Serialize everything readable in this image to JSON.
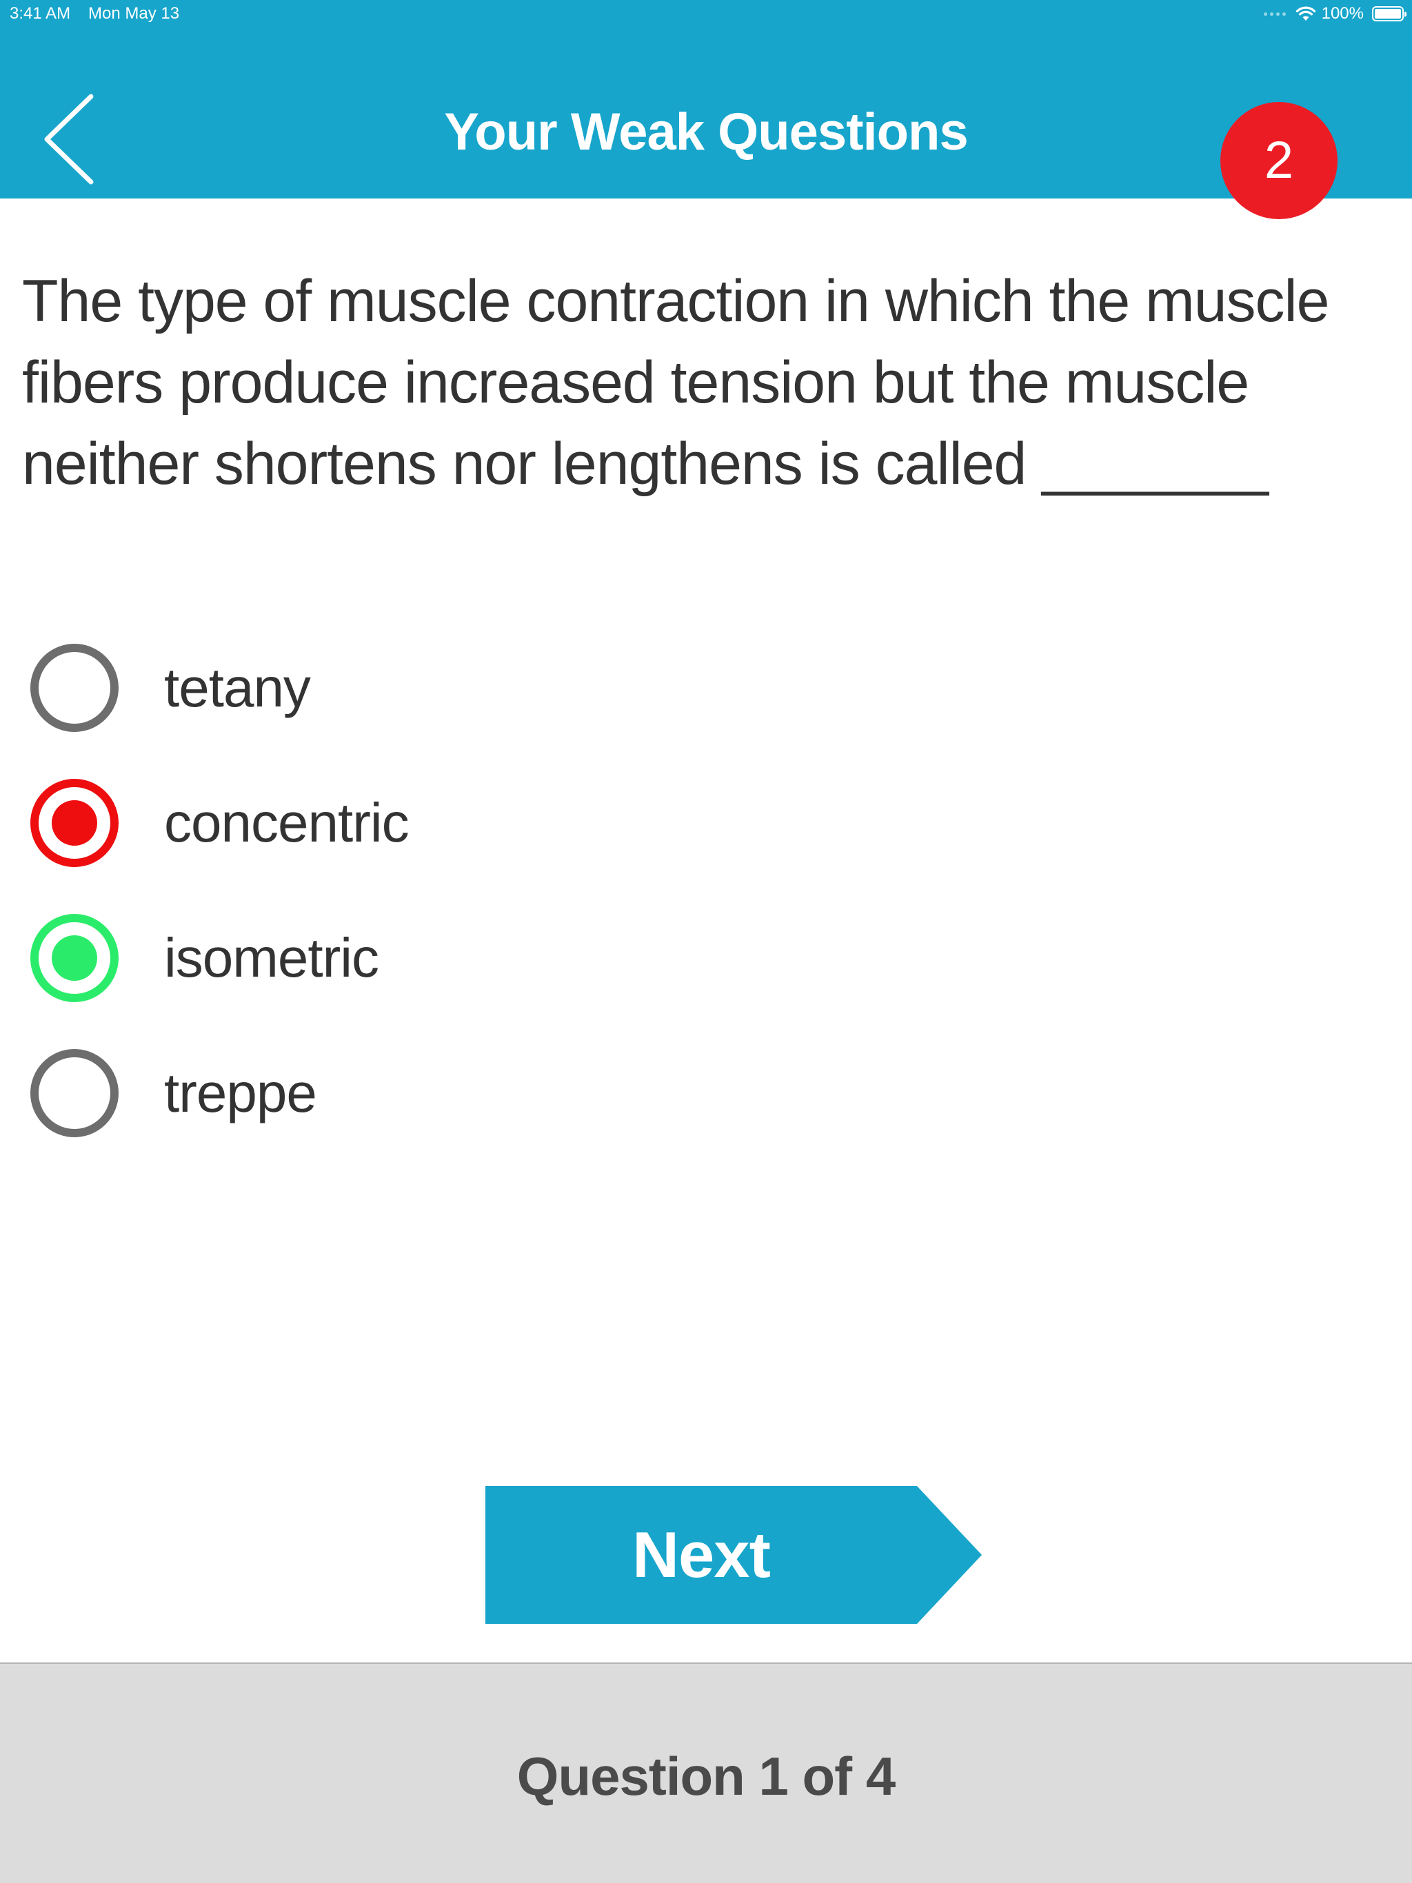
{
  "status_bar": {
    "time": "3:41 AM",
    "date": "Mon May 13",
    "battery_percent": "100%",
    "battery_level": 1.0,
    "wifi_icon": "wifi-icon",
    "battery_icon": "battery-icon"
  },
  "nav": {
    "back_icon": "chevron-left-icon",
    "title": "Your Weak Questions",
    "badge_count": "2"
  },
  "question": {
    "text": "The type of muscle contraction in which the muscle fibers produce increased tension but the muscle neither shortens nor lengthens is called _______"
  },
  "options": [
    {
      "label": "tetany",
      "state": "unselected"
    },
    {
      "label": "concentric",
      "state": "selected-wrong"
    },
    {
      "label": "isometric",
      "state": "correct"
    },
    {
      "label": "treppe",
      "state": "unselected"
    }
  ],
  "next_button": {
    "label": "Next"
  },
  "footer": {
    "progress_text": "Question 1 of 4"
  },
  "colors": {
    "header_blue": "#17a5cb",
    "badge_red": "#ec1c24",
    "wrong_red": "#ee0e10",
    "correct_green": "#2bec6a",
    "unselected_gray": "#6d6d6d",
    "footer_gray": "#dcdcdc"
  }
}
